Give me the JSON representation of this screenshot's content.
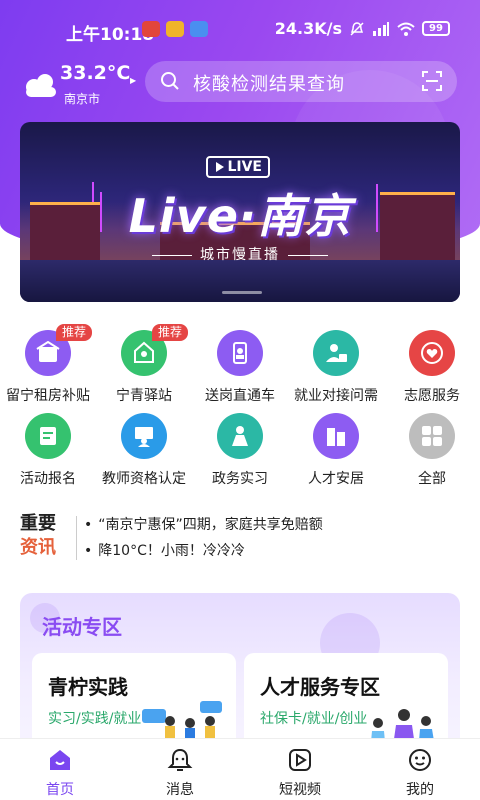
{
  "status_bar": {
    "time": "上午10:18",
    "net_speed": "24.3K/s",
    "battery": "99"
  },
  "weather": {
    "temperature": "33.2°C",
    "city": "南京市",
    "icon": "cloud-icon"
  },
  "search": {
    "placeholder": "核酸检测结果查询",
    "icon": "search-icon",
    "scan_icon": "scan-icon"
  },
  "banner": {
    "tag": "LIVE",
    "title": "Live·南京",
    "subtitle": "城市慢直播"
  },
  "services": [
    {
      "label": "留宁租房补贴",
      "badge": "推荐",
      "icon": "rent-icon",
      "color": "#8d5cf2"
    },
    {
      "label": "宁青驿站",
      "badge": "推荐",
      "icon": "station-icon",
      "color": "#35c26f"
    },
    {
      "label": "送岗直通车",
      "badge": "",
      "icon": "phone-job-icon",
      "color": "#8d5cf2"
    },
    {
      "label": "就业对接问需",
      "badge": "",
      "icon": "job-match-icon",
      "color": "#2bb8a5"
    },
    {
      "label": "志愿服务",
      "badge": "",
      "icon": "volunteer-icon",
      "color": "#e64545"
    },
    {
      "label": "活动报名",
      "badge": "",
      "icon": "signup-icon",
      "color": "#35c26f"
    },
    {
      "label": "教师资格认定",
      "badge": "",
      "icon": "teacher-icon",
      "color": "#2a9be8"
    },
    {
      "label": "政务实习",
      "badge": "",
      "icon": "intern-icon",
      "color": "#2bb8a5"
    },
    {
      "label": "人才安居",
      "badge": "",
      "icon": "housing-icon",
      "color": "#8d5cf2"
    },
    {
      "label": "全部",
      "badge": "",
      "icon": "all-icon",
      "color": "#bdbdbd"
    }
  ],
  "news": {
    "logo_line1": "重要",
    "logo_line2": "资讯",
    "items": [
      "“南京宁惠保”四期，家庭共享免赔额",
      "降10°C！小雨！冷冷冷"
    ]
  },
  "activity_zone": {
    "title": "活动专区",
    "cards": [
      {
        "title": "青柠实践",
        "subtitle": "实习/实践/就业"
      },
      {
        "title": "人才服务专区",
        "subtitle": "社保卡/就业/创业"
      }
    ]
  },
  "tabbar": {
    "active": "首页",
    "tabs": [
      {
        "label": "首页",
        "icon": "home-icon"
      },
      {
        "label": "消息",
        "icon": "bell-icon"
      },
      {
        "label": "短视频",
        "icon": "video-icon"
      },
      {
        "label": "我的",
        "icon": "profile-icon"
      }
    ]
  },
  "colors": {
    "brand": "#8a4cf2",
    "green": "#2aa86b",
    "badge": "#e54544"
  }
}
